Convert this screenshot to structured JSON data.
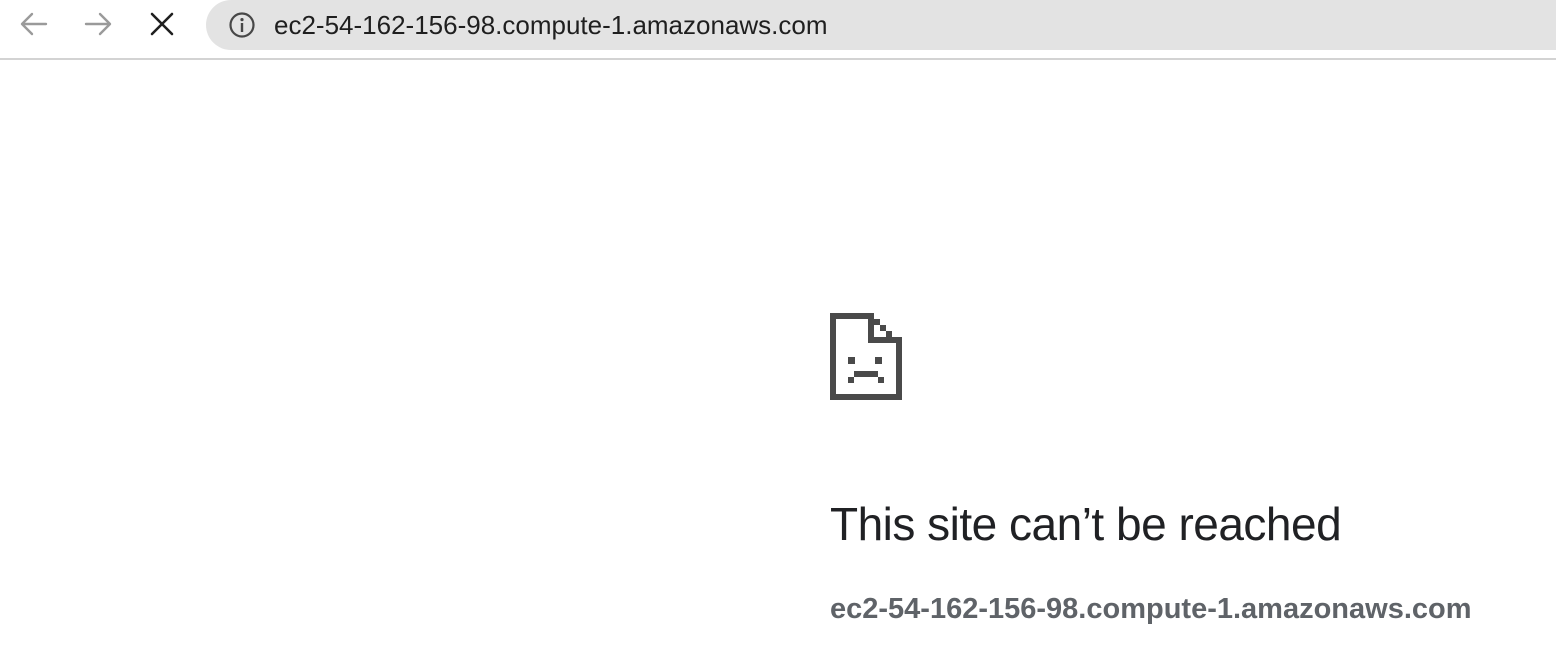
{
  "toolbar": {
    "back_icon": "arrow-left-icon",
    "forward_icon": "arrow-right-icon",
    "stop_icon": "close-icon",
    "omnibox": {
      "info_icon": "info-icon",
      "url": "ec2-54-162-156-98.compute-1.amazonaws.com"
    }
  },
  "error": {
    "icon": "sad-page-icon",
    "title": "This site can’t be reached",
    "host": "ec2-54-162-156-98.compute-1.amazonaws.com"
  },
  "colors": {
    "omnibox_bg": "#e3e3e3",
    "title_text": "#202124",
    "secondary_text": "#5f6368",
    "icon_dark": "#4a4a4a"
  }
}
